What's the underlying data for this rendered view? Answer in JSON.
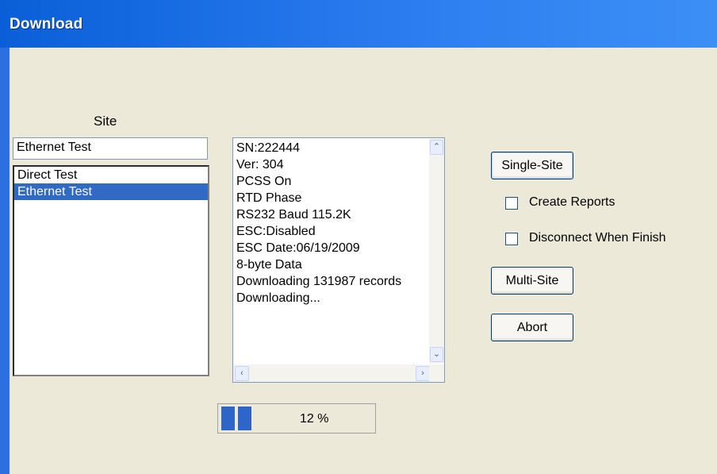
{
  "window": {
    "title": "Download"
  },
  "site": {
    "label": "Site",
    "input_value": "Ethernet Test",
    "list": [
      "Direct Test",
      "Ethernet Test"
    ],
    "selected_index": 1
  },
  "log": {
    "lines": [
      "SN:222444",
      "Ver: 304",
      "PCSS On",
      "RTD Phase",
      "RS232 Baud 115.2K",
      "ESC:Disabled",
      "ESC Date:06/19/2009",
      "8-byte Data",
      "Downloading 131987 records",
      "Downloading..."
    ]
  },
  "buttons": {
    "single_site": "Single-Site",
    "multi_site": "Multi-Site",
    "abort": "Abort"
  },
  "options": {
    "create_reports": {
      "label": "Create Reports",
      "checked": false
    },
    "disconnect_when_finish": {
      "label": "Disconnect When Finish",
      "checked": false
    }
  },
  "progress": {
    "percent_text": "12 %",
    "value": 0.12
  },
  "colors": {
    "titlebar": "#0a5fd8",
    "selection": "#316ac5",
    "progress_fill": "#2e65c9"
  },
  "icons": [
    "scroll-up-icon",
    "scroll-down-icon",
    "scroll-left-icon",
    "scroll-right-icon"
  ]
}
